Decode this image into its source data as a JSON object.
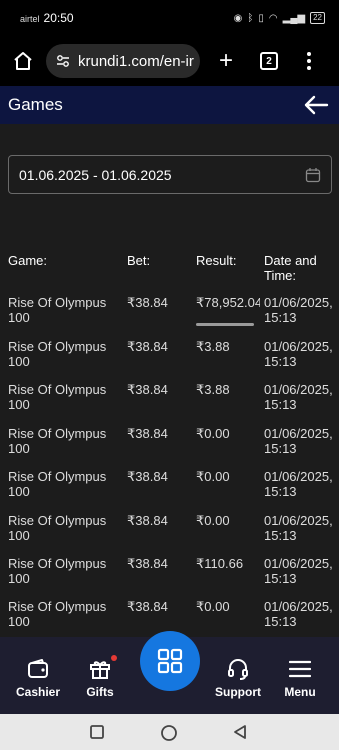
{
  "status_bar": {
    "carrier": "airtel",
    "time": "20:50",
    "battery": "22"
  },
  "browser": {
    "url": "krundi1.com/en-ir",
    "tab_count": "2"
  },
  "header": {
    "title": "Games"
  },
  "filter": {
    "date_range": "01.06.2025 - 01.06.2025"
  },
  "table": {
    "columns": [
      "Game:",
      "Bet:",
      "Result:",
      "Date and Time:"
    ],
    "rows": [
      {
        "game": "Rise Of Olympus 100",
        "bet": "₹38.84",
        "result": "₹78,952.04",
        "datetime": "01/06/2025, 15:13"
      },
      {
        "game": "Rise Of Olympus 100",
        "bet": "₹38.84",
        "result": "₹3.88",
        "datetime": "01/06/2025, 15:13"
      },
      {
        "game": "Rise Of Olympus 100",
        "bet": "₹38.84",
        "result": "₹3.88",
        "datetime": "01/06/2025, 15:13"
      },
      {
        "game": "Rise Of Olympus 100",
        "bet": "₹38.84",
        "result": "₹0.00",
        "datetime": "01/06/2025, 15:13"
      },
      {
        "game": "Rise Of Olympus 100",
        "bet": "₹38.84",
        "result": "₹0.00",
        "datetime": "01/06/2025, 15:13"
      },
      {
        "game": "Rise Of Olympus 100",
        "bet": "₹38.84",
        "result": "₹0.00",
        "datetime": "01/06/2025, 15:13"
      },
      {
        "game": "Rise Of Olympus 100",
        "bet": "₹38.84",
        "result": "₹110.66",
        "datetime": "01/06/2025, 15:13"
      },
      {
        "game": "Rise Of Olympus 100",
        "bet": "₹38.84",
        "result": "₹0.00",
        "datetime": "01/06/2025, 15:13"
      }
    ]
  },
  "bottom_nav": {
    "cashier": "Cashier",
    "gifts": "Gifts",
    "support": "Support",
    "menu": "Menu"
  },
  "colors": {
    "header_bg": "#0d1540",
    "nav_bg": "#1e1e30",
    "accent": "#1577e0",
    "badge": "#e53935"
  }
}
